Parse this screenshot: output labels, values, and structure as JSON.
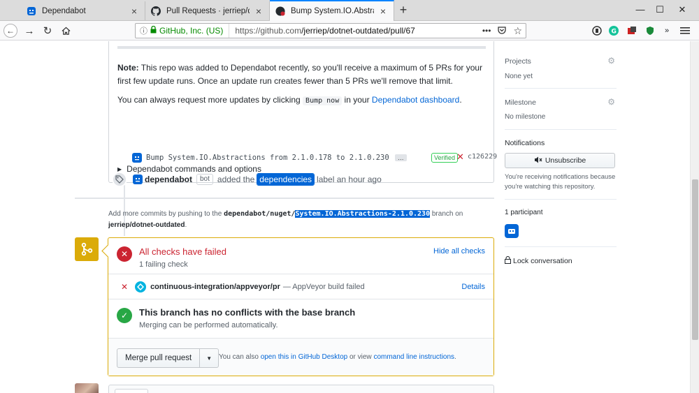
{
  "browser": {
    "tabs": [
      {
        "title": "Dependabot",
        "icon": "dependabot-icon"
      },
      {
        "title": "Pull Requests · jerriep/dotnet-o",
        "icon": "github-icon"
      },
      {
        "title": "Bump System.IO.Abstractions f",
        "icon": "github-failing-icon",
        "active": true
      }
    ],
    "window_controls": {
      "minimize": "—",
      "maximize": "☐",
      "close": "✕"
    },
    "url": {
      "identity": "GitHub, Inc. (US)",
      "prefix": "https://github.com",
      "path": "/jerriep/dotnet-outdated/pull/67",
      "page_actions": "•••"
    }
  },
  "bot_comment": {
    "note_bold": "Note:",
    "note_text": " This repo was added to Dependabot recently, so you'll receive a maximum of 5 PRs for your first few update runs. Once an update run creates fewer than 5 PRs we'll remove that limit.",
    "request_prefix": "You can always request more updates by clicking ",
    "request_kbd": "Bump now",
    "request_mid": " in your ",
    "request_link": "Dependabot dashboard",
    "request_suffix": ".",
    "commands_summary": "Dependabot commands and options"
  },
  "commit": {
    "message": "Bump System.IO.Abstractions from 2.1.0.178 to 2.1.0.230",
    "ellipsis": "…",
    "verified": "Verified",
    "status_x": "✕",
    "sha": "c126229"
  },
  "label_event": {
    "author": "dependabot",
    "bot_tag": "bot",
    "action": "added the",
    "label": "dependencies",
    "suffix": "label an hour ago"
  },
  "push_note": {
    "prefix": "Add more commits by pushing to the ",
    "branch_prefix": "dependabot/nuget/",
    "branch_selected": "System.IO.Abstractions-2.1.0.230",
    "mid": " branch on ",
    "repo": "jerriep/dotnet-outdated",
    "suffix": "."
  },
  "merge": {
    "checks_title": "All checks have failed",
    "checks_sub": "1 failing check",
    "hide_checks": "Hide all checks",
    "check": {
      "context": "continuous-integration/appveyor/pr",
      "description": "— AppVeyor build failed",
      "details": "Details"
    },
    "conflict_title": "This branch has no conflicts with the base branch",
    "conflict_sub": "Merging can be performed automatically.",
    "merge_button": "Merge pull request",
    "also_prefix": "You can also ",
    "also_link1": "open this in GitHub Desktop",
    "also_mid": " or view ",
    "also_link2": "command line instructions",
    "also_suffix": "."
  },
  "sidebar": {
    "projects_title": "Projects",
    "projects_value": "None yet",
    "milestone_title": "Milestone",
    "milestone_value": "No milestone",
    "notifications_title": "Notifications",
    "unsubscribe": "Unsubscribe",
    "notifications_note": "You're receiving notifications because you're watching this repository.",
    "participants": "1 participant",
    "lock": "Lock conversation"
  },
  "colors": {
    "link": "#0366d6",
    "fail": "#cb2431",
    "success": "#28a745",
    "pending": "#dbab09"
  }
}
